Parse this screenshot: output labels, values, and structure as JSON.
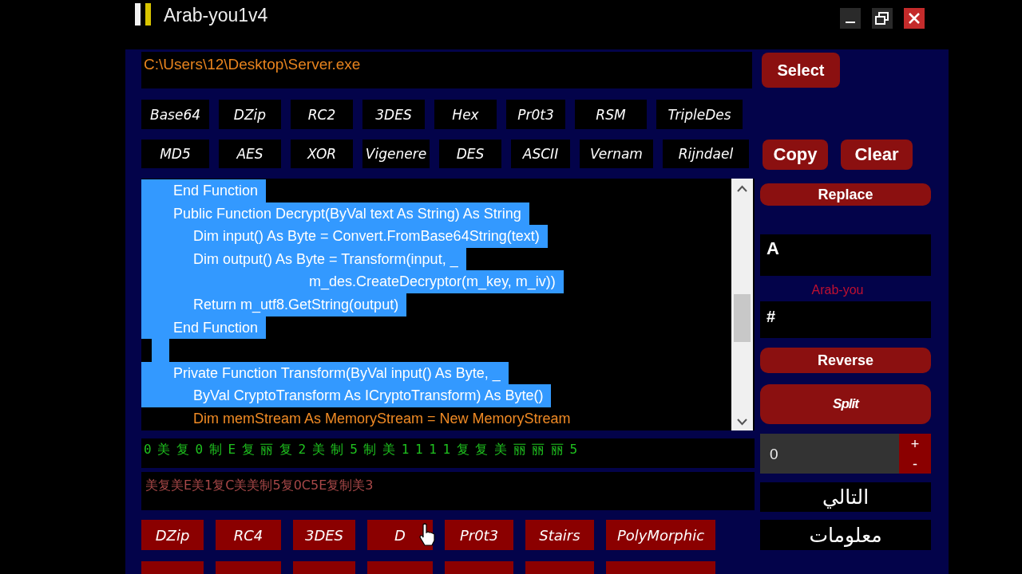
{
  "window": {
    "title": "Arab-you1v4"
  },
  "file_path": {
    "value": "C:\\Users\\12\\Desktop\\Server.exe"
  },
  "select_button": "Select",
  "algorithm_rows": [
    {
      "items": [
        "Base64",
        "DZip",
        "RC2",
        "3DES",
        "Hex",
        "Pr0t3",
        "RSM",
        "TripleDes"
      ]
    },
    {
      "items": [
        "MD5",
        "AES",
        "XOR",
        "Vigenere",
        "DES",
        "ASCII",
        "Vernam",
        "Rijndael"
      ]
    }
  ],
  "copy_button": "Copy",
  "clear_button": "Clear",
  "code_lines": [
    {
      "text": "        End Function",
      "selected": true
    },
    {
      "text": "        Public Function Decrypt(ByVal text As String) As String",
      "selected": true
    },
    {
      "text": "             Dim input() As Byte = Convert.FromBase64String(text)",
      "selected": true
    },
    {
      "text": "             Dim output() As Byte = Transform(input, _",
      "selected": true
    },
    {
      "text": "                                          m_des.CreateDecryptor(m_key, m_iv))",
      "selected": true
    },
    {
      "text": "             Return m_utf8.GetString(output)",
      "selected": true
    },
    {
      "text": "        End Function",
      "selected": true
    },
    {
      "selected": true
    },
    {
      "text": "        Private Function Transform(ByVal input() As Byte, _",
      "selected": true
    },
    {
      "text": "             ByVal CryptoTransform As ICryptoTransform) As Byte()",
      "selected": true
    },
    {
      "text": "             Dim memStream As MemoryStream = New MemoryStream",
      "selected": false
    }
  ],
  "symbol_strip": "0 美 复 0 制 E 复 丽 复 2 美 制 5 制 美 1 1 1 1 复 复 美 丽 丽 丽 5",
  "output_field": {
    "value": "美复美E美1复C美美制5复0C5E复制美3"
  },
  "method_rows": [
    {
      "items": [
        "DZip",
        "RC4",
        "3DES",
        "D",
        "Pr0t3",
        "Stairs",
        "PolyMorphic"
      ]
    }
  ],
  "sidebar": {
    "replace_button": "Replace",
    "find_field": {
      "value": "A"
    },
    "caption": "Arab-you",
    "replace_field": {
      "value": "#"
    },
    "reverse_button": "Reverse",
    "split_button": "Split",
    "counter": {
      "value": "0",
      "increment": "+",
      "decrement": "-"
    },
    "next_button": "التالي",
    "info_button": "معلومات"
  }
}
